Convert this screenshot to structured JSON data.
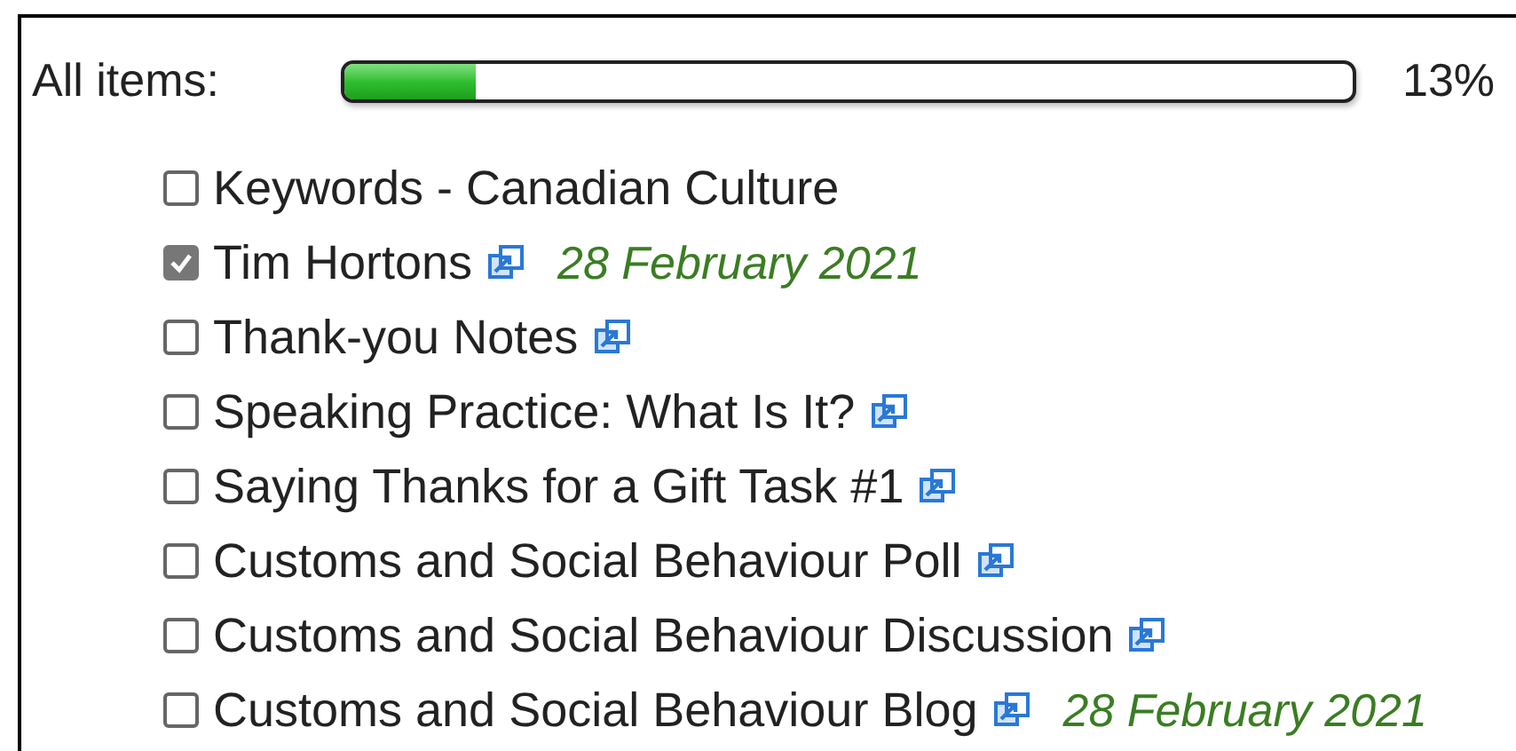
{
  "progress": {
    "label": "All items:",
    "level": 0.13,
    "reading": "13%"
  },
  "items": [
    {
      "title": "Keywords - Canadian Culture",
      "checked": false,
      "link": false
    },
    {
      "title": "Tim Hortons",
      "checked": true,
      "link": true,
      "date": "28 February 2021"
    },
    {
      "title": "Thank-you Notes",
      "checked": false,
      "link": true
    },
    {
      "title": "Speaking Practice: What Is It?",
      "checked": false,
      "link": true
    },
    {
      "title": "Saying Thanks for a Gift Task #1",
      "checked": false,
      "link": true
    },
    {
      "title": "Customs and Social Behaviour Poll",
      "checked": false,
      "link": true
    },
    {
      "title": "Customs and Social Behaviour Discussion",
      "checked": false,
      "link": true
    },
    {
      "title": "Customs and Social Behaviour Blog",
      "checked": false,
      "link": true,
      "date": "28 February 2021"
    }
  ]
}
